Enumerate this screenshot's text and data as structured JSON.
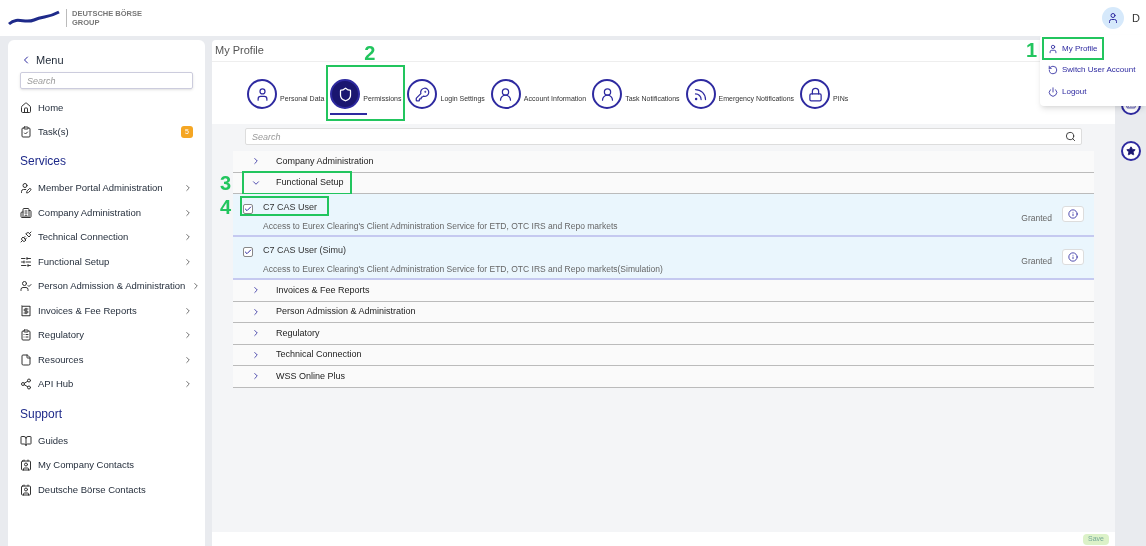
{
  "header": {
    "logo_text": "DEUTSCHE BÖRSE",
    "logo_subtext": "GROUP",
    "avatar_letter": "D"
  },
  "user_menu": {
    "items": [
      {
        "label": "My Profile",
        "annotation": "1"
      },
      {
        "label": "Switch User Account"
      },
      {
        "label": "Logout"
      }
    ]
  },
  "sidebar": {
    "back_label": "Menu",
    "search": {
      "placeholder": "Search"
    },
    "top_items": [
      {
        "label": "Home"
      },
      {
        "label": "Task(s)",
        "badge": "5"
      }
    ],
    "sections": [
      {
        "title": "Services",
        "items": [
          {
            "label": "Member Portal Administration",
            "arrow": true
          },
          {
            "label": "Company Administration",
            "arrow": true
          },
          {
            "label": "Technical Connection",
            "arrow": true
          },
          {
            "label": "Functional Setup",
            "arrow": true
          },
          {
            "label": "Person Admission & Administration",
            "arrow": true
          },
          {
            "label": "Invoices & Fee Reports",
            "arrow": true
          },
          {
            "label": "Regulatory",
            "arrow": true
          },
          {
            "label": "Resources",
            "arrow": true
          },
          {
            "label": "API Hub",
            "arrow": true
          }
        ]
      },
      {
        "title": "Support",
        "items": [
          {
            "label": "Guides",
            "arrow": false
          },
          {
            "label": "My Company Contacts",
            "arrow": false
          },
          {
            "label": "Deutsche Börse Contacts",
            "arrow": false
          }
        ]
      }
    ]
  },
  "page": {
    "title": "My Profile",
    "tabs": [
      {
        "label": "Personal Data",
        "selected": false
      },
      {
        "label": "Permissions",
        "selected": true,
        "annotation": "2"
      },
      {
        "label": "Login Settings",
        "selected": false
      },
      {
        "label": "Account Information",
        "selected": false
      },
      {
        "label": "Task Notifications",
        "selected": false
      },
      {
        "label": "Emergency Notifications",
        "selected": false
      },
      {
        "label": "PINs",
        "selected": false
      }
    ],
    "search": {
      "placeholder": "Search"
    },
    "groups": [
      {
        "label": "Company Administration",
        "expanded": false
      },
      {
        "label": "Functional Setup",
        "expanded": true,
        "annotation": "3",
        "permissions": [
          {
            "name": "C7 CAS User",
            "description": "Access to Eurex Clearing's Client Administration Service for ETD, OTC IRS and Repo markets",
            "status": "Granted",
            "checked": true,
            "annotation": "4"
          },
          {
            "name": "C7 CAS User (Simu)",
            "description": "Access to Eurex Clearing's Client Administration Service for ETD, OTC IRS and Repo markets(Simulation)",
            "status": "Granted",
            "checked": true
          }
        ]
      },
      {
        "label": "Invoices & Fee Reports",
        "expanded": false
      },
      {
        "label": "Person Admission & Administration",
        "expanded": false
      },
      {
        "label": "Regulatory",
        "expanded": false
      },
      {
        "label": "Technical Connection",
        "expanded": false
      },
      {
        "label": "WSS Online Plus",
        "expanded": false
      }
    ],
    "save_button": "Save"
  }
}
